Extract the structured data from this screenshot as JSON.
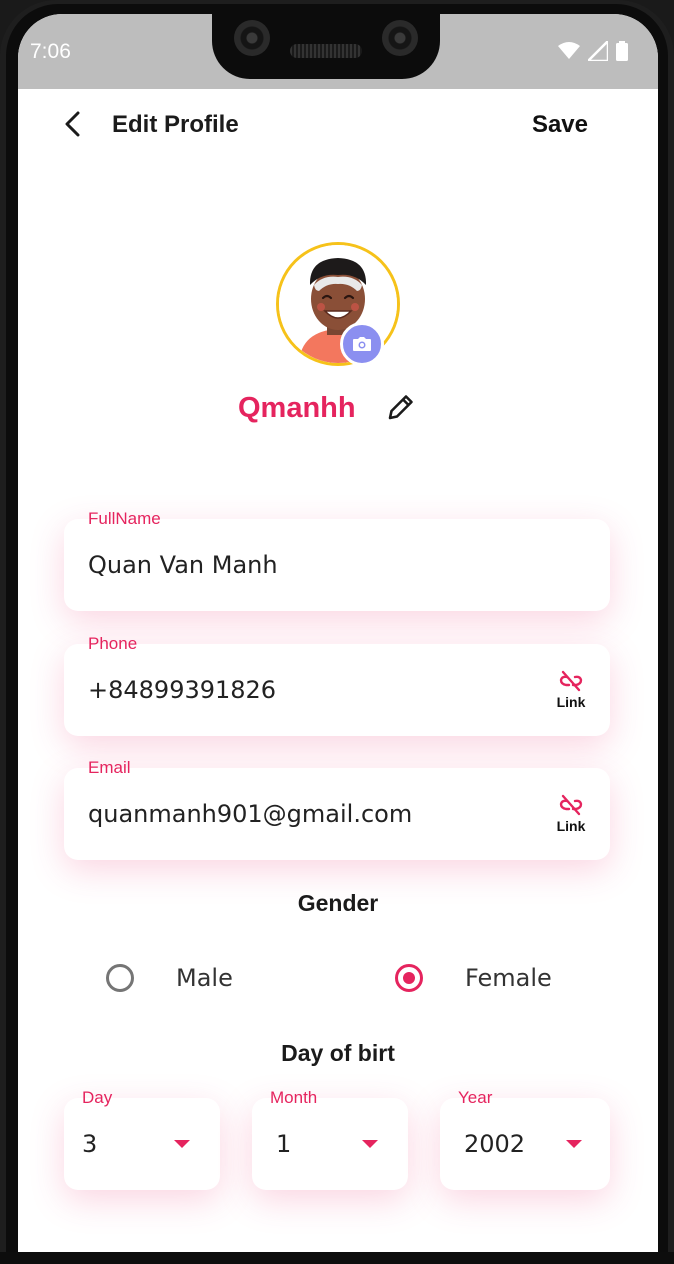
{
  "status_bar": {
    "time": "7:06"
  },
  "header": {
    "title": "Edit Profile",
    "save_label": "Save"
  },
  "profile": {
    "username": "Qmanhh"
  },
  "fields": {
    "fullname": {
      "label": "FullName",
      "value": "Quan Van Manh"
    },
    "phone": {
      "label": "Phone",
      "value": "+84899391826",
      "action_label": "Link"
    },
    "email": {
      "label": "Email",
      "value": "quanmanh901@gmail.com",
      "action_label": "Link"
    }
  },
  "gender": {
    "title": "Gender",
    "options": [
      {
        "label": "Male",
        "selected": false
      },
      {
        "label": "Female",
        "selected": true
      }
    ]
  },
  "birthday": {
    "title": "Day of birt",
    "day": {
      "label": "Day",
      "value": "3"
    },
    "month": {
      "label": "Month",
      "value": "1"
    },
    "year": {
      "label": "Year",
      "value": "2002"
    }
  },
  "colors": {
    "accent": "#e5245e",
    "avatar_ring": "#f6c21a",
    "camera_badge": "#8b8ff0",
    "status_bar": "#bdbdbd"
  },
  "icons": [
    "back-arrow-icon",
    "camera-icon",
    "pencil-icon",
    "link-off-icon",
    "dropdown-caret-icon",
    "wifi-icon",
    "signal-icon",
    "battery-icon"
  ]
}
